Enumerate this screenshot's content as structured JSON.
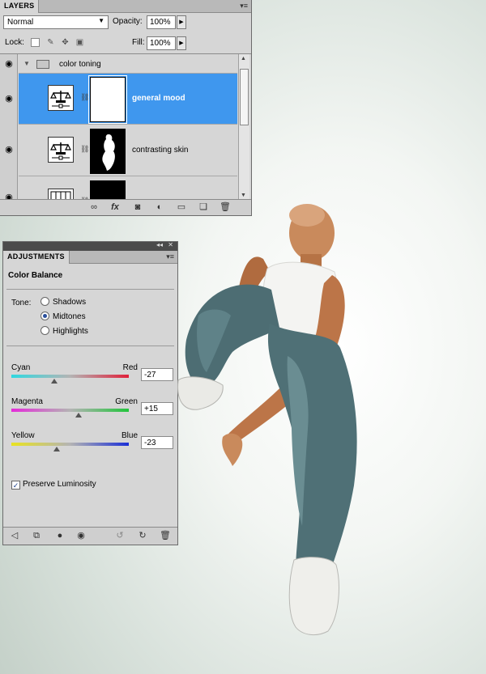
{
  "layers_panel": {
    "tab_label": "LAYERS",
    "blend_mode": "Normal",
    "opacity_label": "Opacity:",
    "opacity_value": "100%",
    "lock_label": "Lock:",
    "fill_label": "Fill:",
    "fill_value": "100%",
    "group": {
      "name": "color toning"
    },
    "layers": [
      {
        "name": "general mood",
        "selected": true
      },
      {
        "name": "contrasting skin",
        "selected": false
      }
    ]
  },
  "adjustments_panel": {
    "tab_label": "ADJUSTMENTS",
    "title": "Color Balance",
    "tone_label": "Tone:",
    "tones": [
      "Shadows",
      "Midtones",
      "Highlights"
    ],
    "selected_tone": "Midtones",
    "sliders": [
      {
        "left": "Cyan",
        "right": "Red",
        "value": "-27",
        "colors": [
          "#2fd8e0",
          "#e0203a"
        ]
      },
      {
        "left": "Magenta",
        "right": "Green",
        "value": "+15",
        "colors": [
          "#e52bd9",
          "#22c43c"
        ]
      },
      {
        "left": "Yellow",
        "right": "Blue",
        "value": "-23",
        "colors": [
          "#e9e31f",
          "#1b2fd6"
        ]
      }
    ],
    "preserve_luminosity_label": "Preserve Luminosity",
    "preserve_luminosity_checked": true
  },
  "icons": {
    "eye": "eye-icon",
    "link": "link-layers-icon",
    "fx": "layer-style-icon",
    "mask": "add-mask-icon",
    "adjustment": "new-adjustment-icon",
    "folder": "new-group-icon",
    "new_layer": "new-layer-icon",
    "trash": "delete-icon"
  },
  "accent_color": "#3f97ee"
}
